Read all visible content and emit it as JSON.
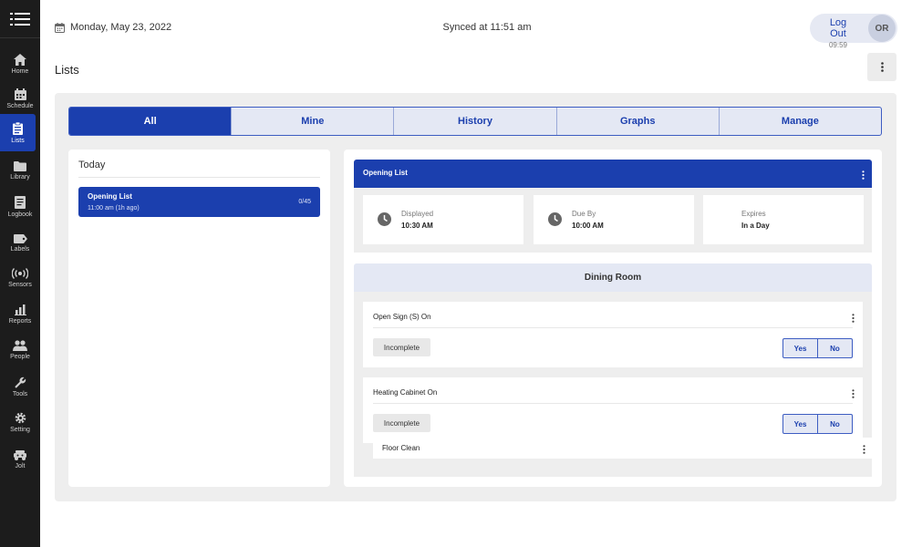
{
  "header": {
    "date": "Monday, May 23, 2022",
    "sync_status": "Synced at 11:51 am",
    "logout_label": "Log Out",
    "session_timer": "09:59",
    "user_initials": "OR"
  },
  "page": {
    "title": "Lists"
  },
  "sidebar": {
    "items": [
      {
        "label": "Home"
      },
      {
        "label": "Schedule"
      },
      {
        "label": "Lists"
      },
      {
        "label": "Library"
      },
      {
        "label": "Logbook"
      },
      {
        "label": "Labels"
      },
      {
        "label": "Sensors"
      },
      {
        "label": "Reports"
      },
      {
        "label": "People"
      },
      {
        "label": "Tools"
      },
      {
        "label": "Setting"
      },
      {
        "label": "Jolt"
      }
    ],
    "active": "Lists"
  },
  "tabs": [
    {
      "label": "All",
      "active": true
    },
    {
      "label": "Mine"
    },
    {
      "label": "History"
    },
    {
      "label": "Graphs"
    },
    {
      "label": "Manage"
    }
  ],
  "left_panel": {
    "day_heading": "Today",
    "lists": [
      {
        "name": "Opening List",
        "time": "11:00 am (1h ago)",
        "progress": "0/45"
      }
    ]
  },
  "detail": {
    "title": "Opening List",
    "info": [
      {
        "label": "Displayed",
        "value": "10:30 AM"
      },
      {
        "label": "Due By",
        "value": "10:00 AM"
      },
      {
        "label": "Expires",
        "value": "In a Day"
      }
    ],
    "section": "Dining Room",
    "tasks": [
      {
        "name": "Open Sign (S) On",
        "status": "Incomplete",
        "yes": "Yes",
        "no": "No"
      },
      {
        "name": "Heating Cabinet On",
        "status": "Incomplete",
        "yes": "Yes",
        "no": "No"
      },
      {
        "name": "Floor Clean"
      }
    ]
  },
  "colors": {
    "primary": "#1b3fae",
    "sidebar_bg": "#1c1c1c",
    "panel_bg": "#eeeeee",
    "tab_bg": "#e4e8f4"
  }
}
